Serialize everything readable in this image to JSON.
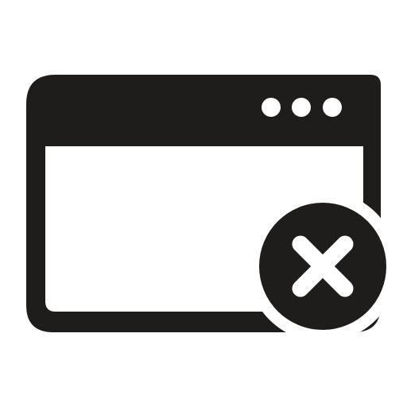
{
  "icon": {
    "name": "browser-window-close-icon",
    "color": "#1f1c1c",
    "background": "#ffffff",
    "window": {
      "title_bar_dots": 3
    },
    "badge": {
      "icon": "close-icon"
    }
  }
}
